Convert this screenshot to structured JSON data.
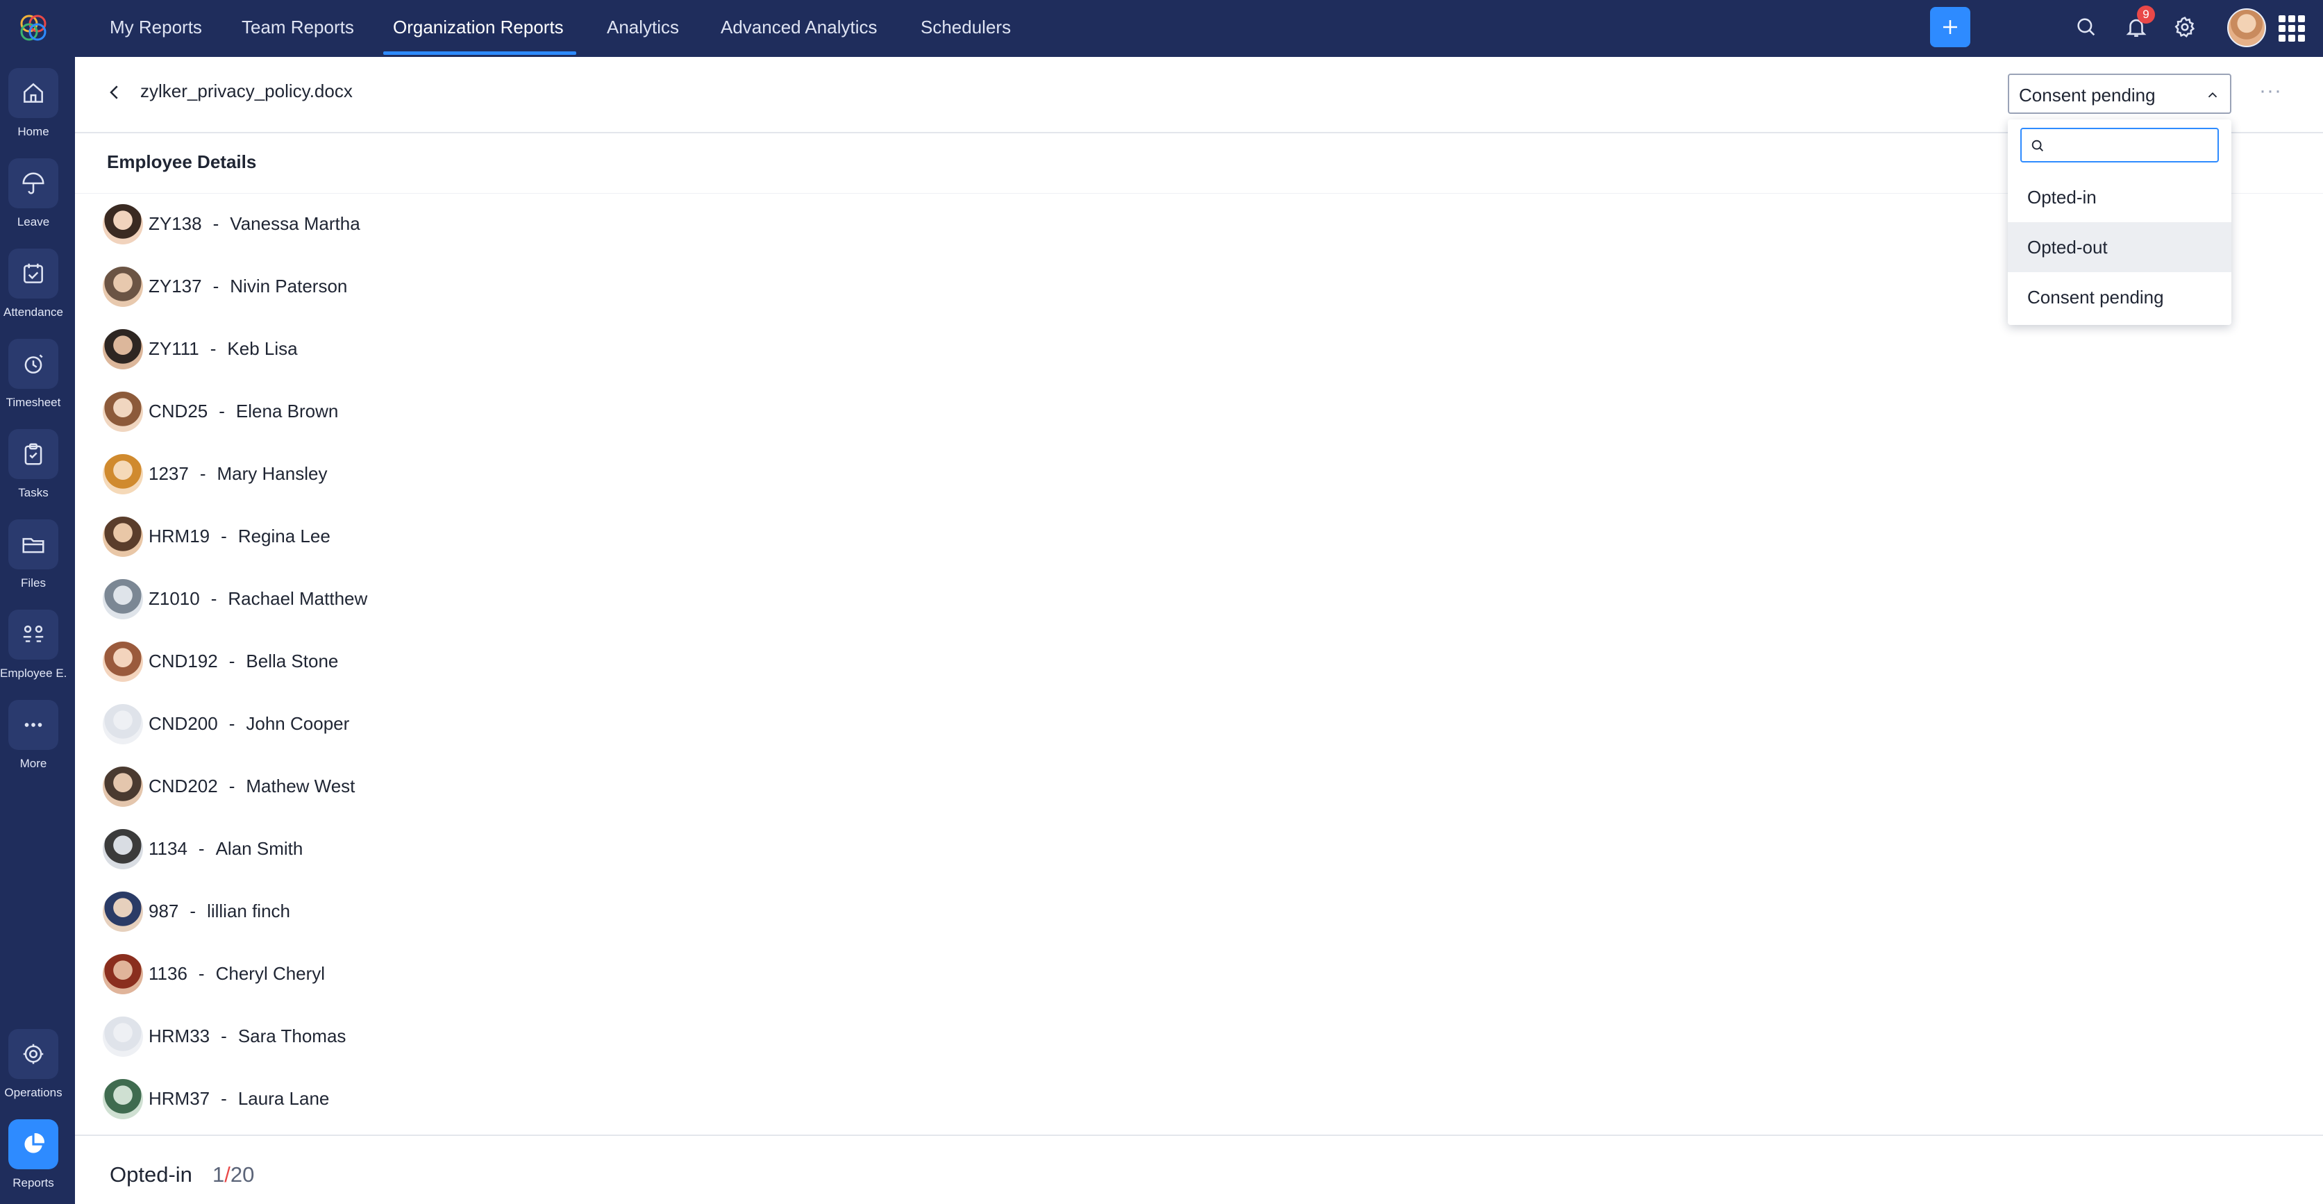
{
  "sidebar": {
    "items": [
      {
        "label": "Home",
        "icon": "home-icon"
      },
      {
        "label": "Leave",
        "icon": "umbrella-icon"
      },
      {
        "label": "Attendance",
        "icon": "calendar-check-icon"
      },
      {
        "label": "Timesheet",
        "icon": "clock-icon"
      },
      {
        "label": "Tasks",
        "icon": "clipboard-check-icon"
      },
      {
        "label": "Files",
        "icon": "folder-icon"
      },
      {
        "label": "Employee E...",
        "icon": "employee-engagement-icon"
      },
      {
        "label": "More",
        "icon": "more-icon"
      },
      {
        "label": "Operations",
        "icon": "operations-icon"
      },
      {
        "label": "Reports",
        "icon": "pie-chart-icon"
      }
    ]
  },
  "topbar": {
    "tabs": [
      {
        "label": "My Reports"
      },
      {
        "label": "Team Reports"
      },
      {
        "label": "Organization Reports"
      },
      {
        "label": "Analytics"
      },
      {
        "label": "Advanced Analytics"
      },
      {
        "label": "Schedulers"
      }
    ],
    "active_tab": "Organization Reports",
    "notification_count": "9",
    "accent_color": "#2e8bff",
    "bar_color": "#1f2d5c"
  },
  "header": {
    "document_title": "zylker_privacy_policy.docx",
    "status_value": "Consent pending"
  },
  "dropdown": {
    "search_placeholder": "",
    "options": [
      {
        "label": "Opted-in"
      },
      {
        "label": "Opted-out"
      },
      {
        "label": "Consent pending"
      }
    ]
  },
  "section": {
    "title": "Employee Details"
  },
  "employees": [
    {
      "id": "ZY138",
      "name": "Vanessa Martha"
    },
    {
      "id": "ZY137",
      "name": "Nivin Paterson"
    },
    {
      "id": "ZY111",
      "name": "Keb Lisa"
    },
    {
      "id": "CND25",
      "name": "Elena Brown"
    },
    {
      "id": "1237",
      "name": "Mary Hansley"
    },
    {
      "id": "HRM19",
      "name": "Regina Lee"
    },
    {
      "id": "Z1010",
      "name": "Rachael Matthew"
    },
    {
      "id": "CND192",
      "name": "Bella Stone"
    },
    {
      "id": "CND200",
      "name": "John Cooper"
    },
    {
      "id": "CND202",
      "name": "Mathew West"
    },
    {
      "id": "1134",
      "name": "Alan Smith"
    },
    {
      "id": "987",
      "name": "lillian finch"
    },
    {
      "id": "1136",
      "name": "Cheryl Cheryl"
    },
    {
      "id": "HRM33",
      "name": "Sara Thomas"
    },
    {
      "id": "HRM37",
      "name": "Laura Lane"
    }
  ],
  "footer": {
    "label": "Opted-in",
    "count": "1",
    "separator": "/",
    "total": "20"
  }
}
